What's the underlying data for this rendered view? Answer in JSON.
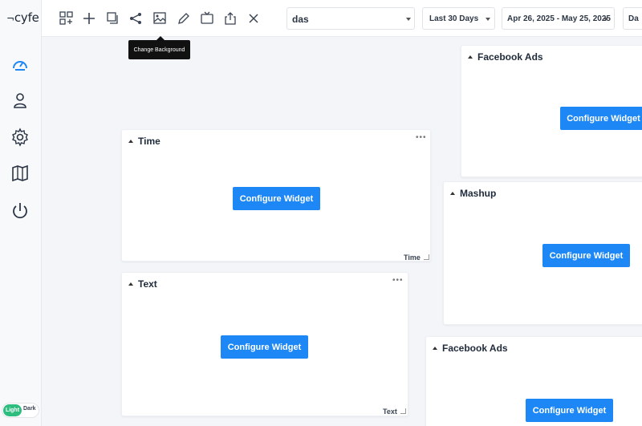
{
  "app": {
    "logo": "cyfe"
  },
  "sidebar": {
    "items": [
      {
        "name": "dashboard-icon"
      },
      {
        "name": "user-icon"
      },
      {
        "name": "settings-icon"
      },
      {
        "name": "book-icon"
      },
      {
        "name": "power-icon"
      }
    ],
    "theme": {
      "light": "Light",
      "dark": "Dark"
    }
  },
  "toolbar": {
    "icons": [
      "add-widget-icon",
      "plus-icon",
      "copy-icon",
      "share-icon",
      "change-background-icon",
      "edit-icon",
      "tv-icon",
      "export-icon",
      "close-icon"
    ],
    "tooltip": "Change Background",
    "dashboard_select": "das",
    "range_select": "Last 30 Days",
    "dates_select": "Apr 26, 2025 - May 25, 2025",
    "extra_select": "Da"
  },
  "widgets": [
    {
      "title": "Time",
      "button": "Configure Widget",
      "footer": "Time"
    },
    {
      "title": "Text",
      "button": "Configure Widget",
      "footer": "Text"
    },
    {
      "title": "Facebook Ads",
      "button": "Configure Widget"
    },
    {
      "title": "Mashup",
      "button": "Configure Widget"
    },
    {
      "title": "Facebook Ads",
      "button": "Configure Widget"
    }
  ],
  "colors": {
    "accent": "#1c87f5",
    "toggle": "#2dbd7e",
    "background": "#f3f5f9"
  }
}
